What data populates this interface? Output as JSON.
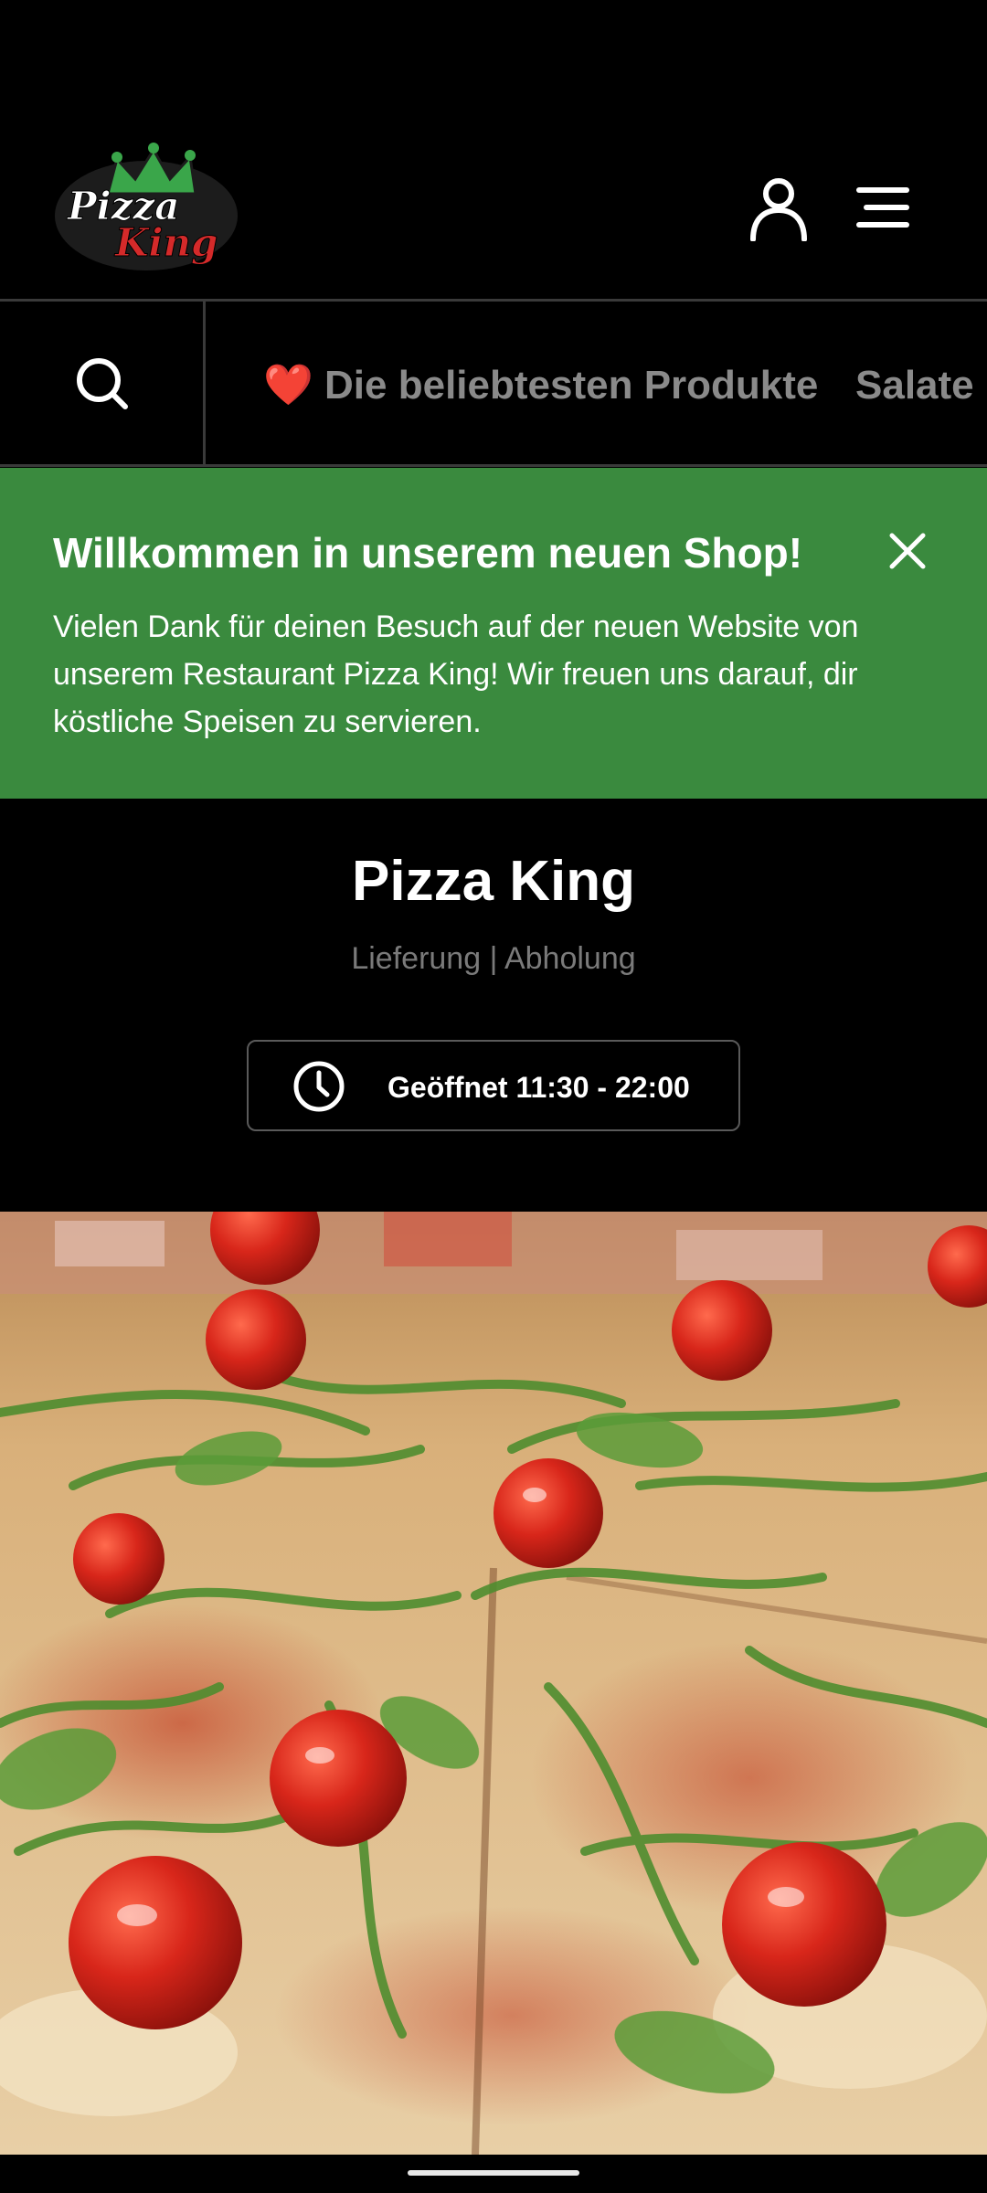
{
  "header": {
    "logo_text_top": "Pizza",
    "logo_text_bottom": "King"
  },
  "nav": {
    "categories": [
      {
        "emoji": "❤️",
        "label": "Die beliebtesten Produkte"
      },
      {
        "label": "Salate"
      }
    ]
  },
  "banner": {
    "title": "Willkommen in unserem neuen Shop!",
    "text": "Vielen Dank für deinen Besuch auf der neuen Website von unserem Restaurant Pizza King! Wir freuen uns darauf, dir köstliche Speisen zu servieren."
  },
  "restaurant": {
    "name": "Pizza King",
    "modes": "Lieferung | Abholung",
    "hours_label": "Geöffnet 11:30 - 22:00"
  },
  "colors": {
    "background": "#000000",
    "banner_green": "#3a8a3e",
    "muted_text": "#8a8a8a",
    "logo_red": "#d42a2a",
    "logo_green": "#3aa64a"
  },
  "icons": {
    "user": "user-icon",
    "menu": "hamburger-menu-icon",
    "search": "search-icon",
    "close": "close-icon",
    "clock": "clock-icon"
  }
}
